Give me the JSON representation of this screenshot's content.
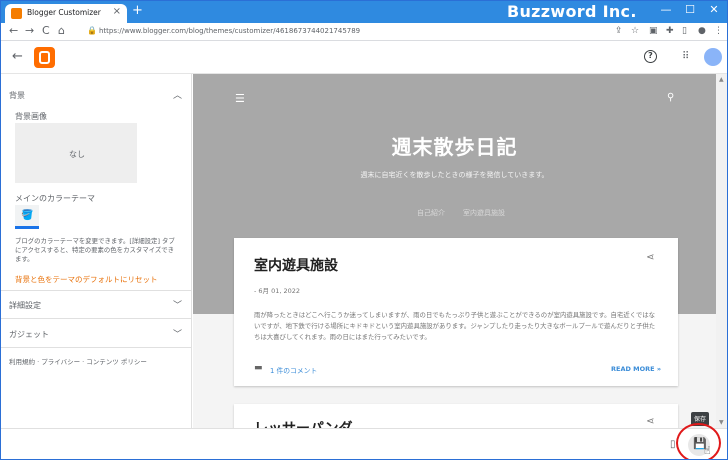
{
  "browser": {
    "tab_title": "Blogger Customizer",
    "tab_close": "×",
    "new_tab": "+",
    "brand": "Buzzword Inc.",
    "window_controls": [
      "—",
      "☐",
      "✕"
    ],
    "nav": {
      "back": "←",
      "forward": "→",
      "reload": "C",
      "home": "⌂"
    },
    "url": "https://www.blogger.com/blog/themes/customizer/4618673744021745789",
    "toolbar_icons": [
      "share-icon",
      "star-icon",
      "extension-icon",
      "puzzle-icon",
      "sidebar-icon",
      "profile-icon",
      "menu-icon"
    ]
  },
  "header": {
    "back": "←",
    "help": "?",
    "apps": "⠿",
    "logo_color": "#ff6d00"
  },
  "sidebar": {
    "background_section": "背景",
    "background_image_label": "背景画像",
    "background_image_value": "なし",
    "main_color_theme_label": "メインのカラーテーマ",
    "theme_desc": "ブログのカラーテーマを変更できます。[詳細設定] タブにアクセスすると、特定の要素の色をカスタマイズできます。",
    "reset_link": "背景と色をテーマのデフォルトにリセット",
    "advanced_section": "詳細設定",
    "gadget_section": "ガジェット",
    "footer_links": "利用規約 · プライバシー · コンテンツ ポリシー",
    "accent_color": "#1a73e8",
    "link_color": "#e8710a"
  },
  "preview": {
    "blog_title": "週末散歩日記",
    "blog_description": "週末に自宅近くを散歩したときの様子を発信していきます。",
    "page_links": [
      "自己紹介",
      "室内遊具施設"
    ],
    "post1": {
      "title": "室内遊具施設",
      "date": "- 6月 01, 2022",
      "body": "雨が降ったときはどこへ行こうか迷ってしまいますが、雨の日でもたっぷり子供と遊ぶことができるのが室内遊具施設です。自宅近くではないですが、地下鉄で行ける場所にキドキドという室内遊具施設があります。ジャンプしたり走ったり大きなボールプールで遊んだりと子供たちは大喜びしてくれます。雨の日にはまた行ってみたいです。",
      "comments": "1 件のコメント",
      "read_more": "READ MORE »"
    },
    "post2": {
      "title": "レッサーパンダ"
    },
    "hero_color": "#a8a8a8",
    "link_color": "#3c8dd8"
  },
  "bottombar": {
    "save_icon": "save-icon",
    "tooltip": "保存"
  }
}
